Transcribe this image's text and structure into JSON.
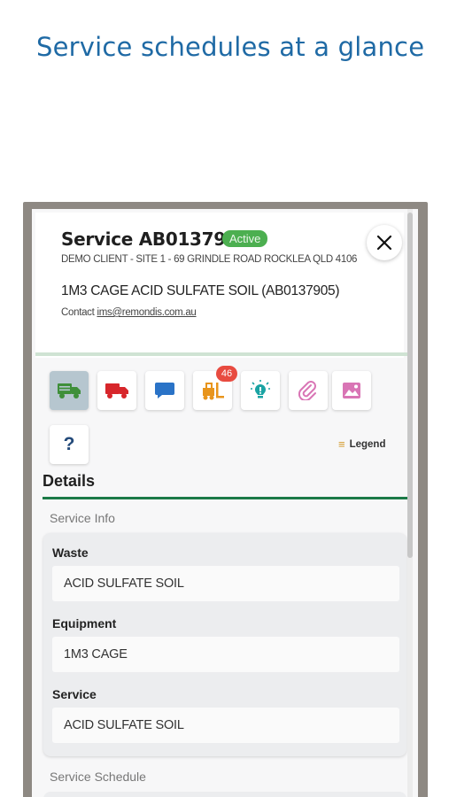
{
  "headline": "Service schedules at a glance",
  "service": {
    "title": "Service AB0137905",
    "status": "Active",
    "address": "DEMO CLIENT - SITE 1 - 69 GRINDLE ROAD ROCKLEA QLD 4106",
    "product": "1M3 CAGE ACID SULFATE SOIL (AB0137905)",
    "contact_label": "Contact",
    "contact_email": "ims@remondis.com.au"
  },
  "toolbar": {
    "icons": [
      "truck-list-icon",
      "truck-icon",
      "chat-icon",
      "forklift-icon",
      "alert-bulb-icon",
      "paperclip-icon",
      "image-icon",
      "help-icon"
    ],
    "forklift_badge": "46",
    "help_label": "?",
    "legend_label": "Legend",
    "colors": {
      "active_bg": "#b6c6cf",
      "green": "#3f8f3a",
      "red": "#d7262b",
      "blue": "#2a73c7",
      "orange": "#e8951c",
      "teal": "#1aa3a3",
      "pink": "#d975b5",
      "badge": "#e84b40"
    }
  },
  "details": {
    "title": "Details",
    "service_info_label": "Service Info",
    "fields": [
      {
        "label": "Waste",
        "value": "ACID SULFATE SOIL"
      },
      {
        "label": "Equipment",
        "value": "1M3 CAGE"
      },
      {
        "label": "Service",
        "value": "ACID SULFATE SOIL"
      }
    ],
    "schedule_label": "Service Schedule"
  }
}
